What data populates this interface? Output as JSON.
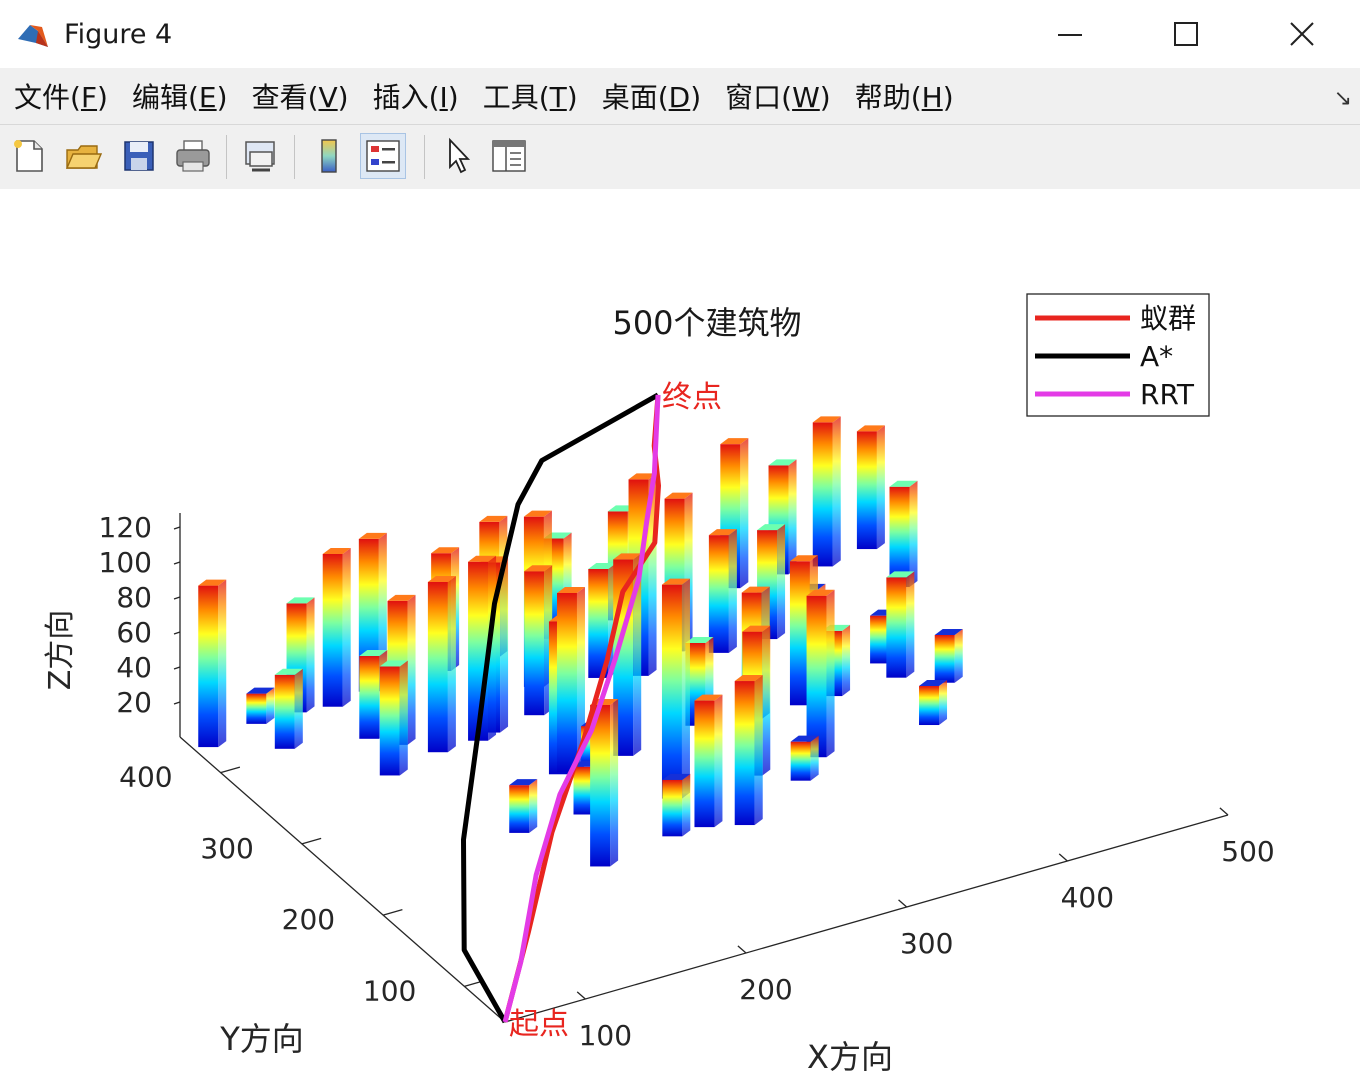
{
  "window": {
    "title": "Figure 4",
    "minimize_glyph": "—",
    "maximize_glyph": "☐",
    "close_glyph": "✕"
  },
  "menu": [
    {
      "pre": "文件(",
      "key": "F",
      "post": ")"
    },
    {
      "pre": "编辑(",
      "key": "E",
      "post": ")"
    },
    {
      "pre": "查看(",
      "key": "V",
      "post": ")"
    },
    {
      "pre": "插入(",
      "key": "I",
      "post": ")"
    },
    {
      "pre": "工具(",
      "key": "T",
      "post": ")"
    },
    {
      "pre": "桌面(",
      "key": "D",
      "post": ")"
    },
    {
      "pre": "窗口(",
      "key": "W",
      "post": ")"
    },
    {
      "pre": "帮助(",
      "key": "H",
      "post": ")"
    }
  ],
  "menu_dock_glyph": "↘",
  "toolbar": [
    {
      "name": "new-figure-icon"
    },
    {
      "name": "open-file-icon"
    },
    {
      "name": "save-icon"
    },
    {
      "name": "print-icon"
    },
    {
      "name": "link-plot-icon"
    },
    {
      "name": "colorbar-icon"
    },
    {
      "name": "legend-icon"
    },
    {
      "name": "pointer-icon"
    },
    {
      "name": "property-inspector-icon"
    }
  ],
  "chart_data": {
    "type": "3d-bar-path",
    "title": "500个建筑物",
    "xlabel": "X方向",
    "ylabel": "Y方向",
    "zlabel": "Z方向",
    "xticks": [
      "100",
      "200",
      "300",
      "400",
      "500"
    ],
    "yticks": [
      "100",
      "200",
      "300",
      "400"
    ],
    "zticks": [
      "20",
      "40",
      "60",
      "80",
      "100",
      "120"
    ],
    "xlim": [
      50,
      500
    ],
    "ylim": [
      50,
      450
    ],
    "zlim": [
      0,
      120
    ],
    "colormap": "jet",
    "legend": {
      "placement": "top-right",
      "entries": [
        {
          "label": "蚁群",
          "color": "#e8251f"
        },
        {
          "label": "A*",
          "color": "#000000"
        },
        {
          "label": "RRT",
          "color": "#e33be6"
        }
      ]
    },
    "annotations": [
      {
        "text": "起点",
        "color": "#e8251f",
        "at": [
          50,
          50,
          0
        ]
      },
      {
        "text": "终点",
        "color": "#e8251f",
        "at": [
          345,
          445,
          120
        ]
      }
    ],
    "buildings": [
      [
        60,
        435,
        90
      ],
      [
        95,
        445,
        15
      ],
      [
        95,
        410,
        40
      ],
      [
        120,
        445,
        60
      ],
      [
        140,
        440,
        85
      ],
      [
        165,
        445,
        85
      ],
      [
        210,
        445,
        65
      ],
      [
        240,
        445,
        75
      ],
      [
        280,
        445,
        55
      ],
      [
        320,
        445,
        60
      ],
      [
        390,
        445,
        80
      ],
      [
        420,
        445,
        60
      ],
      [
        445,
        440,
        80
      ],
      [
        475,
        445,
        65
      ],
      [
        470,
        395,
        55
      ],
      [
        150,
        380,
        80
      ],
      [
        130,
        350,
        60
      ],
      [
        140,
        395,
        45
      ],
      [
        190,
        360,
        100
      ],
      [
        200,
        365,
        95
      ],
      [
        165,
        360,
        95
      ],
      [
        230,
        370,
        80
      ],
      [
        245,
        400,
        95
      ],
      [
        280,
        390,
        60
      ],
      [
        300,
        380,
        110
      ],
      [
        330,
        395,
        85
      ],
      [
        350,
        380,
        65
      ],
      [
        380,
        380,
        60
      ],
      [
        395,
        360,
        30
      ],
      [
        420,
        320,
        25
      ],
      [
        210,
        300,
        85
      ],
      [
        215,
        300,
        100
      ],
      [
        230,
        300,
        20
      ],
      [
        250,
        300,
        110
      ],
      [
        300,
        310,
        45
      ],
      [
        330,
        300,
        70
      ],
      [
        360,
        300,
        80
      ],
      [
        380,
        300,
        35
      ],
      [
        420,
        300,
        55
      ],
      [
        440,
        280,
        25
      ],
      [
        160,
        250,
        25
      ],
      [
        200,
        250,
        25
      ],
      [
        250,
        240,
        120
      ],
      [
        300,
        240,
        80
      ],
      [
        340,
        240,
        90
      ],
      [
        410,
        240,
        20
      ],
      [
        180,
        190,
        90
      ],
      [
        230,
        200,
        30
      ],
      [
        250,
        200,
        70
      ],
      [
        270,
        190,
        80
      ],
      [
        320,
        220,
        20
      ]
    ],
    "paths": [
      {
        "name": "蚁群",
        "color": "#e8251f",
        "points": [
          [
            50,
            50,
            0
          ],
          [
            100,
            120,
            10
          ],
          [
            150,
            190,
            25
          ],
          [
            200,
            250,
            40
          ],
          [
            240,
            300,
            55
          ],
          [
            270,
            340,
            70
          ],
          [
            300,
            360,
            82
          ],
          [
            320,
            395,
            95
          ],
          [
            330,
            420,
            105
          ],
          [
            345,
            445,
            120
          ]
        ]
      },
      {
        "name": "A*",
        "color": "#000000",
        "points": [
          [
            50,
            50,
            0
          ],
          [
            60,
            120,
            10
          ],
          [
            100,
            200,
            30
          ],
          [
            140,
            260,
            60
          ],
          [
            180,
            320,
            95
          ],
          [
            230,
            390,
            110
          ],
          [
            260,
            420,
            115
          ],
          [
            345,
            445,
            120
          ]
        ]
      },
      {
        "name": "RRT",
        "color": "#e33be6",
        "points": [
          [
            50,
            50,
            0
          ],
          [
            80,
            90,
            10
          ],
          [
            120,
            150,
            25
          ],
          [
            160,
            200,
            40
          ],
          [
            200,
            240,
            50
          ],
          [
            240,
            290,
            60
          ],
          [
            280,
            340,
            75
          ],
          [
            300,
            370,
            90
          ],
          [
            320,
            400,
            100
          ],
          [
            345,
            445,
            120
          ]
        ]
      }
    ]
  }
}
